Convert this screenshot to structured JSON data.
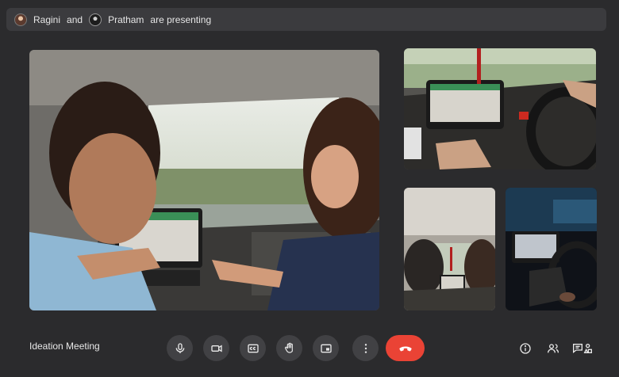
{
  "banner": {
    "presenter_1": "Ragini",
    "conjunction": "and",
    "presenter_2": "Pratham",
    "suffix": "are presenting"
  },
  "meeting": {
    "title": "Ideation Meeting"
  },
  "controls": {
    "mic": "microphone-icon",
    "camera": "video-camera-icon",
    "captions": "closed-captions-icon",
    "raise_hand": "raise-hand-icon",
    "present": "present-screen-icon",
    "more": "more-options-icon",
    "end_call": "hang-up-icon"
  },
  "side_controls": {
    "info": "info-icon",
    "people": "people-icon",
    "chat": "chat-activities-icon"
  },
  "colors": {
    "background": "#2b2b2d",
    "control_bg": "#414144",
    "end_call": "#ea4335"
  }
}
